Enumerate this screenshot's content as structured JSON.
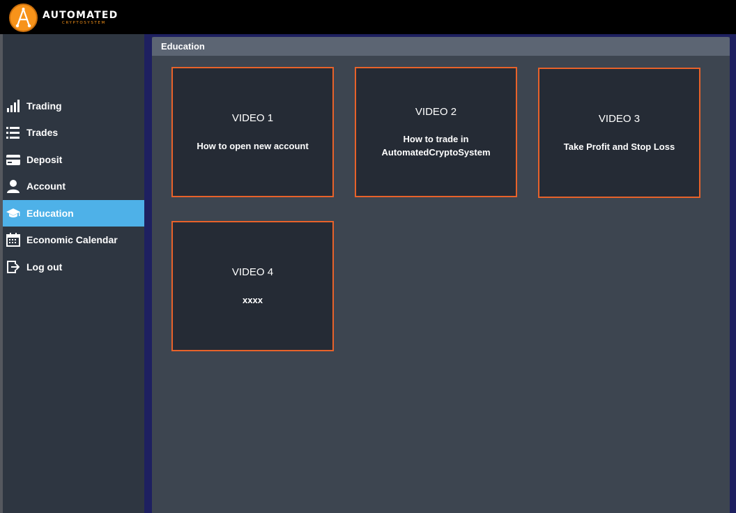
{
  "brand": {
    "title": "AUTOMATED",
    "subtitle": "CRYPTOSYSTEM",
    "accent": "#f7931a"
  },
  "sidebar": {
    "items": [
      {
        "label": "Trading",
        "icon": "bar-chart-icon",
        "active": false
      },
      {
        "label": "Trades",
        "icon": "list-icon",
        "active": false
      },
      {
        "label": "Deposit",
        "icon": "credit-card-icon",
        "active": false
      },
      {
        "label": "Account",
        "icon": "user-icon",
        "active": false
      },
      {
        "label": "Education",
        "icon": "graduation-cap-icon",
        "active": true
      },
      {
        "label": "Economic Calendar",
        "icon": "calendar-icon",
        "active": false
      },
      {
        "label": "Log out",
        "icon": "logout-icon",
        "active": false
      }
    ],
    "active_color": "#4eb1e8"
  },
  "main": {
    "header": "Education",
    "cards": [
      {
        "title": "VIDEO 1",
        "description": "How to open new account"
      },
      {
        "title": "VIDEO 2",
        "description": "How to trade in AutomatedCryptoSystem"
      },
      {
        "title": "VIDEO 3",
        "description": "Take Profit and Stop Loss"
      },
      {
        "title": "VIDEO 4",
        "description": "xxxx"
      }
    ],
    "card_border_color": "#e8622a"
  }
}
